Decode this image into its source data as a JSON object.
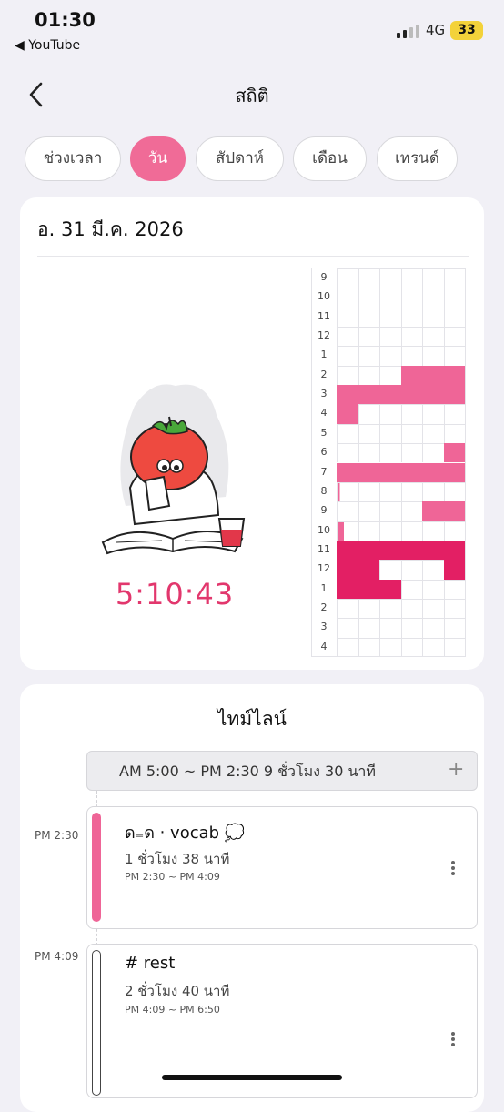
{
  "status": {
    "time": "01:30",
    "back_app": "◀ YouTube",
    "network": "4G",
    "battery": "33"
  },
  "header": {
    "title": "สถิติ"
  },
  "tabs": [
    {
      "label": "ช่วงเวลา",
      "active": false
    },
    {
      "label": "วัน",
      "active": true
    },
    {
      "label": "สัปดาห์",
      "active": false
    },
    {
      "label": "เดือน",
      "active": false
    },
    {
      "label": "เทรนด์",
      "active": false
    }
  ],
  "day": {
    "date": "อ. 31 มี.ค. 2026",
    "total": "5:10:43",
    "hour_labels": [
      "9",
      "10",
      "11",
      "12",
      "1",
      "2",
      "3",
      "4",
      "5",
      "6",
      "7",
      "8",
      "9",
      "10",
      "11",
      "12",
      "1",
      "2",
      "3",
      "4"
    ],
    "grid_legend": "each row = 1 hour, 6 cells of 10 minutes; 0 empty, 1 light, 2 dark, small fractions = thin slivers",
    "grid": [
      [
        0,
        0,
        0,
        0,
        0,
        0
      ],
      [
        0,
        0,
        0,
        0,
        0,
        0
      ],
      [
        0,
        0,
        0,
        0,
        0,
        0
      ],
      [
        0,
        0,
        0,
        0,
        0,
        0
      ],
      [
        0,
        0,
        0,
        0,
        0,
        0
      ],
      [
        0,
        0,
        0,
        1,
        1,
        1
      ],
      [
        1,
        1,
        1,
        1,
        1,
        1
      ],
      [
        1,
        0,
        0,
        0,
        0,
        0
      ],
      [
        0,
        0,
        0,
        0,
        0,
        0
      ],
      [
        0,
        0,
        0,
        0,
        0,
        1
      ],
      [
        1,
        1,
        1,
        1,
        1,
        1
      ],
      [
        0.1,
        0,
        0,
        0,
        0,
        0
      ],
      [
        0,
        0,
        0,
        0,
        1,
        1
      ],
      [
        0.3,
        0,
        0,
        0,
        0,
        0
      ],
      [
        2,
        2,
        2,
        2,
        2,
        2
      ],
      [
        2,
        2,
        0,
        0,
        0,
        2
      ],
      [
        2,
        2,
        2,
        0,
        0,
        0
      ],
      [
        0,
        0,
        0,
        0,
        0,
        0
      ],
      [
        0,
        0,
        0,
        0,
        0,
        0
      ],
      [
        0,
        0,
        0,
        0,
        0,
        0
      ]
    ],
    "colors": {
      "light": "#ef6597",
      "dark": "#e31f64",
      "accent": "#e2376d"
    }
  },
  "timeline": {
    "title": "ไทม์ไลน์",
    "summary": "AM 5:00 ~ PM 2:30  9 ชั่วโมง 30 นาที",
    "entries": [
      {
        "left_time": "PM 2:30",
        "name": "ด₌ด ‧ vocab 💭",
        "duration": "1 ชั่วโมง 38 นาที",
        "range": "PM 2:30 ~ PM 4:09",
        "color": "#ef6597"
      },
      {
        "left_time": "PM 4:09",
        "name": "# rest",
        "duration": "2 ชั่วโมง 40 นาที",
        "range": "PM 4:09 ~ PM 6:50",
        "color": "#ffffff"
      }
    ]
  }
}
